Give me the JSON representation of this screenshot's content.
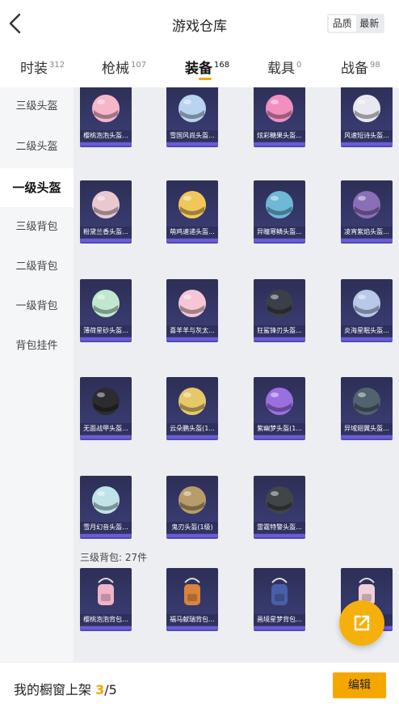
{
  "header": {
    "title": "游戏仓库",
    "sort": [
      "品质",
      "最新"
    ],
    "sort_active": 0
  },
  "tabs": [
    {
      "label": "时装",
      "count": "312"
    },
    {
      "label": "枪械",
      "count": "107"
    },
    {
      "label": "装备",
      "count": "168"
    },
    {
      "label": "载具",
      "count": "0"
    },
    {
      "label": "战备",
      "count": "98"
    }
  ],
  "active_tab": 2,
  "sidebar": {
    "items": [
      "三级头盔",
      "二级头盔",
      "一级头盔",
      "三级背包",
      "二级背包",
      "一级背包",
      "背包挂件"
    ],
    "active": 2
  },
  "items": [
    {
      "name": "樱桃泡泡头盔...",
      "color": "#f4b6c8"
    },
    {
      "name": "雪国风尚头盔...",
      "color": "#b8d4f0"
    },
    {
      "name": "炫彩糖果头盔...",
      "color": "#f08fc0"
    },
    {
      "name": "风速短诗头盔...",
      "color": "#e8e8f0"
    },
    {
      "name": "粉黛兰香头盔...",
      "color": "#e9c9cf"
    },
    {
      "name": "萌鸡速递头盔...",
      "color": "#f2c75a"
    },
    {
      "name": "异瞳寒鳞头盔...",
      "color": "#6fb8d6"
    },
    {
      "name": "凌宵紫焰头盔...",
      "color": "#8a6fb8"
    },
    {
      "name": "薄荷星砂头盔...",
      "color": "#bfe8cf"
    },
    {
      "name": "喜羊羊与灰太...",
      "color": "#f5c6d6"
    },
    {
      "name": "狂鲨锋刃头盔...",
      "color": "#3b3f48"
    },
    {
      "name": "炎海星眠头盔...",
      "color": "#b9c7e8"
    },
    {
      "name": "无面战甲头盔...",
      "color": "#2c2c30"
    },
    {
      "name": "云朵鹏头盔(1...",
      "color": "#e6c76a"
    },
    {
      "name": "紫幽梦头盔(1...",
      "color": "#9a6fe0"
    },
    {
      "name": "异域翅翼头盔...",
      "color": "#52626f"
    },
    {
      "name": "雪月幻音头盔...",
      "color": "#bfe3e8"
    },
    {
      "name": "鬼刃头盔(1级)",
      "color": "#b89d6a"
    },
    {
      "name": "雷霆特警头盔...",
      "color": "#404648"
    }
  ],
  "section": {
    "label": "三级背包: 27件"
  },
  "backpacks": [
    {
      "name": "樱桃泡泡背包...",
      "color": "#f1b3c8"
    },
    {
      "name": "福马献瑞背包...",
      "color": "#d9833c"
    },
    {
      "name": "画境星梦背包...",
      "color": "#4a5ea8"
    },
    {
      "name": "...",
      "color": "#f0d0d8"
    }
  ],
  "bottom": {
    "shelf_label": "我的橱窗上架 ",
    "shelf_current": "3",
    "shelf_total": "/5",
    "edit": "编辑"
  },
  "colors": {
    "accent": "#f5a700",
    "card_bg": "#2d2f56",
    "card_border": "#6a5cd6"
  }
}
